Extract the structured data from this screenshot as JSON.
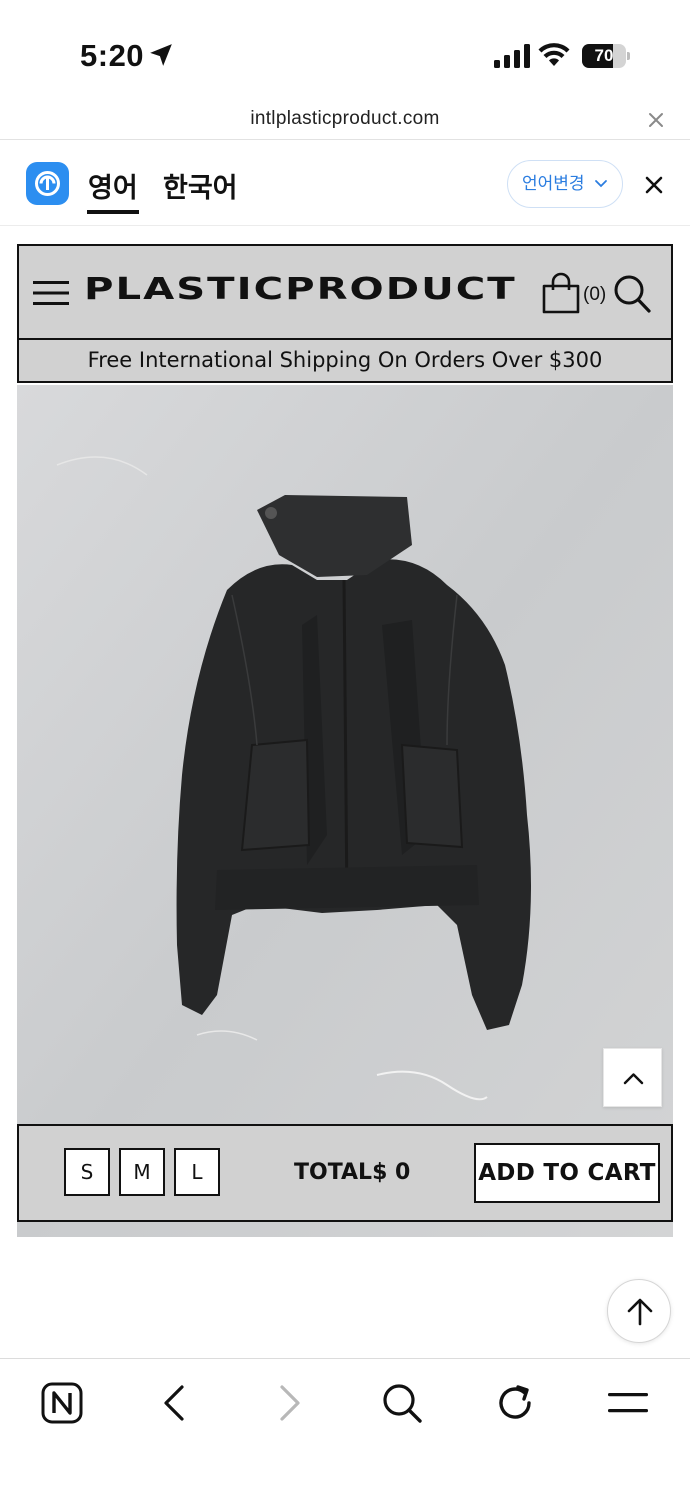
{
  "status_bar": {
    "time": "5:20",
    "battery": "70",
    "battery_level": 0.7
  },
  "browser": {
    "url": "intlplasticproduct.com"
  },
  "translate_bar": {
    "tab_english": "영어",
    "tab_korean": "한국어",
    "change_language": "언어변경"
  },
  "site": {
    "logo": "PLASTICPRODUCT",
    "cart_count": "(0)",
    "shipping_banner": "Free International Shipping On Orders Over $300"
  },
  "product": {
    "sizes": [
      "S",
      "M",
      "L"
    ],
    "total_label": "TOTAL",
    "total_value": "$ 0",
    "add_to_cart": "ADD TO CART"
  },
  "icons": {
    "colors": {
      "accent_blue": "#2b7de0",
      "header_gray": "#d1d1d1",
      "border": "#111111"
    }
  }
}
